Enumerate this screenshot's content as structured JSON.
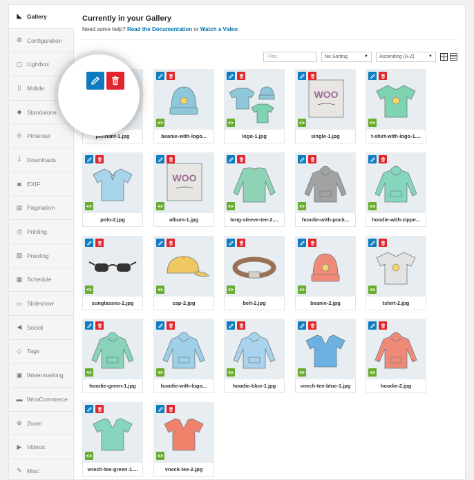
{
  "sidebar": {
    "items": [
      {
        "label": "Gallery",
        "icon": "gallery-icon",
        "active": true
      },
      {
        "label": "Configuration",
        "icon": "gear-icon"
      },
      {
        "label": "Lightbox",
        "icon": "lightbox-icon"
      },
      {
        "label": "Mobile",
        "icon": "mobile-icon"
      },
      {
        "label": "Standalone",
        "icon": "standalone-icon"
      },
      {
        "label": "Pinterest",
        "icon": "pinterest-icon"
      },
      {
        "label": "Downloads",
        "icon": "download-icon"
      },
      {
        "label": "EXIF",
        "icon": "camera-icon"
      },
      {
        "label": "Pagination",
        "icon": "pagination-icon"
      },
      {
        "label": "Printing",
        "icon": "printer-icon"
      },
      {
        "label": "Proofing",
        "icon": "proofing-icon"
      },
      {
        "label": "Schedule",
        "icon": "calendar-icon"
      },
      {
        "label": "Slideshow",
        "icon": "slideshow-icon"
      },
      {
        "label": "Social",
        "icon": "megaphone-icon"
      },
      {
        "label": "Tags",
        "icon": "tag-icon"
      },
      {
        "label": "Watermarking",
        "icon": "lock-icon"
      },
      {
        "label": "WooCommerce",
        "icon": "woocommerce-icon"
      },
      {
        "label": "Zoom",
        "icon": "zoom-icon"
      },
      {
        "label": "Videos",
        "icon": "video-icon"
      },
      {
        "label": "Misc",
        "icon": "misc-icon"
      }
    ]
  },
  "header": {
    "title": "Currently in your Gallery",
    "help_prefix": "Need some help?",
    "doc_link": "Read the Documentation",
    "or_text": "or",
    "video_link": "Watch a Video"
  },
  "toolbar": {
    "filter_placeholder": "Filter",
    "sorting": "No Sorting",
    "order": "Ascending (A-Z)"
  },
  "colors": {
    "edit": "#0d7cc1",
    "delete": "#e0262c",
    "view": "#6aac2f",
    "link": "#0073aa",
    "thumb_bg": "#e7edf1"
  },
  "gallery": {
    "items": [
      {
        "filename": "pennant-1.jpg",
        "art": "pennant-icon",
        "color": "#e7e9ea"
      },
      {
        "filename": "beanie-with-logo...",
        "art": "beanie-icon",
        "color": "#8ec6da"
      },
      {
        "filename": "logo-1.jpg",
        "art": "clothing-set-icon",
        "color": "#8ec6da"
      },
      {
        "filename": "single-1.jpg",
        "art": "album-icon",
        "color": "#9f6a99"
      },
      {
        "filename": "t-shirt-with-logo-1....",
        "art": "tshirt-icon",
        "color": "#7ed3b0"
      },
      {
        "filename": "polo-2.jpg",
        "art": "polo-icon",
        "color": "#a8d4ea"
      },
      {
        "filename": "album-1.jpg",
        "art": "album-icon",
        "color": "#9f6a99"
      },
      {
        "filename": "long-sleeve-tee-2....",
        "art": "longsleeve-icon",
        "color": "#8fd3b6"
      },
      {
        "filename": "hoodie-with-pock...",
        "art": "hoodie-icon",
        "color": "#a2a2a2"
      },
      {
        "filename": "hoodie-with-zippe...",
        "art": "hoodie-icon",
        "color": "#86d6bd"
      },
      {
        "filename": "sunglasses-2.jpg",
        "art": "sunglasses-icon",
        "color": "#333333"
      },
      {
        "filename": "cap-2.jpg",
        "art": "cap-icon",
        "color": "#f0c862"
      },
      {
        "filename": "belt-2.jpg",
        "art": "belt-icon",
        "color": "#9a7056"
      },
      {
        "filename": "beanie-2.jpg",
        "art": "beanie-icon",
        "color": "#f08a78"
      },
      {
        "filename": "tshirt-2.jpg",
        "art": "tshirt-icon",
        "color": "#e3e3e3"
      },
      {
        "filename": "hoodie-green-1.jpg",
        "art": "hoodie-icon",
        "color": "#8ad3bb"
      },
      {
        "filename": "hoodie-with-logo...",
        "art": "hoodie-icon",
        "color": "#9fd0ea"
      },
      {
        "filename": "hoodie-blue-1.jpg",
        "art": "hoodie-icon",
        "color": "#a9d2ec"
      },
      {
        "filename": "vnech-tee-blue-1.jpg",
        "art": "vneck-icon",
        "color": "#6cb2e0"
      },
      {
        "filename": "hoodie-2.jpg",
        "art": "hoodie-icon",
        "color": "#f08a78"
      },
      {
        "filename": "vnech-tee-green-1....",
        "art": "vneck-icon",
        "color": "#86d6bd"
      },
      {
        "filename": "vneck-tee-2.jpg",
        "art": "vneck-icon",
        "color": "#f0826c"
      }
    ]
  }
}
